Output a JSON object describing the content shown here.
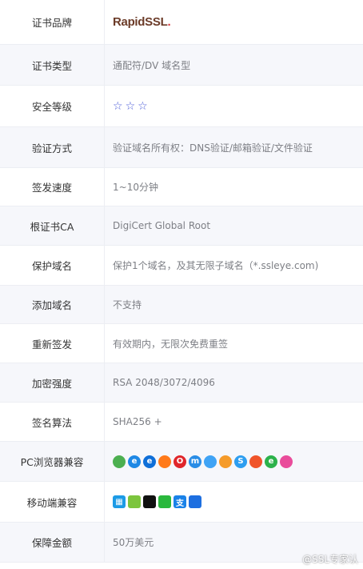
{
  "rows": [
    {
      "label": "证书品牌",
      "brand": "RapidSSL",
      "brand_dot": "."
    },
    {
      "label": "证书类型",
      "value": "通配符/DV 域名型"
    },
    {
      "label": "安全等级",
      "stars": [
        "☆",
        "☆",
        "☆"
      ]
    },
    {
      "label": "验证方式",
      "value": "验证域名所有权：DNS验证/邮箱验证/文件验证"
    },
    {
      "label": "签发速度",
      "value": "1~10分钟"
    },
    {
      "label": "根证书CA",
      "value": "DigiCert Global Root"
    },
    {
      "label": "保护域名",
      "value": "保护1个域名，及其无限子域名（*.ssleye.com)"
    },
    {
      "label": "添加域名",
      "value": "不支持"
    },
    {
      "label": "重新签发",
      "value": "有效期内，无限次免费重签"
    },
    {
      "label": "加密强度",
      "value": "RSA 2048/3072/4096"
    },
    {
      "label": "签名算法",
      "value": "SHA256 +"
    },
    {
      "label": "PC浏览器兼容"
    },
    {
      "label": "移动端兼容"
    },
    {
      "label": "保障金额",
      "value": "50万美元"
    }
  ],
  "pc_browsers": [
    {
      "name": "chrome-icon",
      "glyph": "",
      "color": "#4caf50"
    },
    {
      "name": "ie-icon",
      "glyph": "e",
      "color": "#1e88e5"
    },
    {
      "name": "edge-icon",
      "glyph": "e",
      "color": "#0f6fd8"
    },
    {
      "name": "firefox-icon",
      "glyph": "",
      "color": "#ff7a1a"
    },
    {
      "name": "opera-icon",
      "glyph": "O",
      "color": "#e0262b"
    },
    {
      "name": "maxthon-icon",
      "glyph": "m",
      "color": "#2a8de6"
    },
    {
      "name": "qq-browser-icon",
      "glyph": "",
      "color": "#3fa3f5"
    },
    {
      "name": "uc-browser-icon",
      "glyph": "",
      "color": "#f59b2a"
    },
    {
      "name": "sogou-icon",
      "glyph": "S",
      "color": "#2e9ef0"
    },
    {
      "name": "baidu-browser-icon",
      "glyph": "",
      "color": "#f0542a"
    },
    {
      "name": "360-browser-icon",
      "glyph": "e",
      "color": "#2cb24b"
    },
    {
      "name": "other-browser-icon",
      "glyph": "",
      "color": "#e94c9b"
    }
  ],
  "mobile_platforms": [
    {
      "name": "windows-icon",
      "glyph": "▦",
      "color": "#1c9be6"
    },
    {
      "name": "android-icon",
      "glyph": "",
      "color": "#7cc53d"
    },
    {
      "name": "apple-icon",
      "glyph": "",
      "color": "#111111"
    },
    {
      "name": "wechat-icon",
      "glyph": "",
      "color": "#2ab83d"
    },
    {
      "name": "alipay-icon",
      "glyph": "支",
      "color": "#1a82e8"
    },
    {
      "name": "safari-icon",
      "glyph": "",
      "color": "#1d6fe0"
    }
  ],
  "watermark": "@SSL专家认"
}
